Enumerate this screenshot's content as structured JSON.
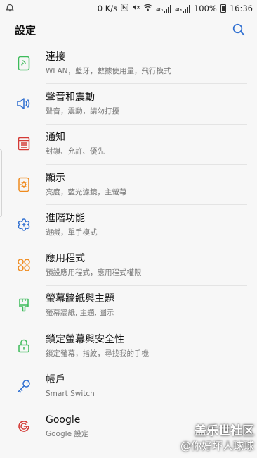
{
  "status": {
    "speed": "0 K/s",
    "net_4g": "4G",
    "net_4g_lte": "4G",
    "battery": "100%",
    "time": "16:36"
  },
  "header": {
    "title": "設定"
  },
  "items": [
    {
      "label": "連接",
      "sub": "WLAN，藍牙，數據使用量，飛行模式"
    },
    {
      "label": "聲音和震動",
      "sub": "聲音，震動，請勿打擾"
    },
    {
      "label": "通知",
      "sub": "封鎖、允許、優先"
    },
    {
      "label": "顯示",
      "sub": "亮度，藍光濾鏡，主螢幕"
    },
    {
      "label": "進階功能",
      "sub": "遊戲，單手模式"
    },
    {
      "label": "應用程式",
      "sub": "預設應用程式，應用程式權限"
    },
    {
      "label": "螢幕牆紙與主題",
      "sub": "螢幕牆紙, 主題, 圖示"
    },
    {
      "label": "鎖定螢幕與安全性",
      "sub": "鎖定螢幕，指紋，尋找我的手機"
    },
    {
      "label": "帳戶",
      "sub": "Smart Switch"
    },
    {
      "label": "Google",
      "sub": "Google 設定"
    }
  ],
  "watermark": {
    "line1": "盖乐世社区",
    "line2": "@你好坏人球球"
  }
}
